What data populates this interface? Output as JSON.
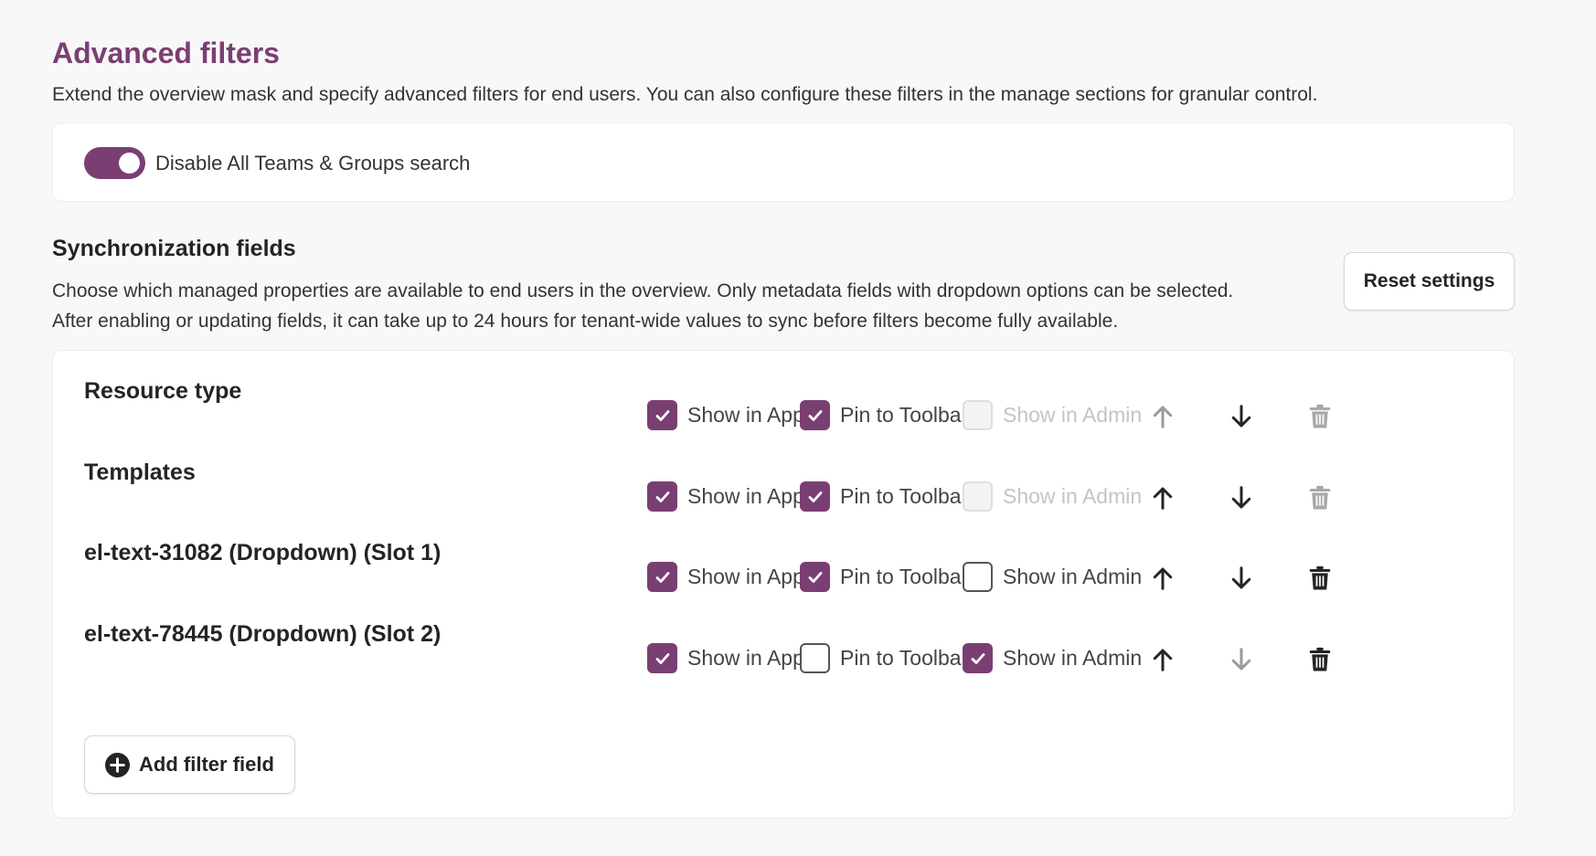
{
  "page": {
    "title": "Advanced filters",
    "description": "Extend the overview mask and specify advanced filters for end users. You can also configure these filters in the manage sections for granular control."
  },
  "toggle": {
    "label": "Disable All Teams & Groups search",
    "on": true
  },
  "sync": {
    "title": "Synchronization fields",
    "description_line1": "Choose which managed properties are available to end users in the overview. Only metadata fields with dropdown options can be selected.",
    "description_line2": "After enabling or updating fields, it can take up to 24 hours for tenant-wide values to sync before filters become fully available.",
    "reset_label": "Reset settings",
    "add_label": "Add filter field"
  },
  "labels": {
    "show_in_app": "Show in App",
    "pin_to_toolbar": "Pin to Toolbar",
    "show_in_admin": "Show in Admin"
  },
  "fields": [
    {
      "name": "Resource type",
      "show_in_app": true,
      "pin_to_toolbar": true,
      "show_in_admin": false,
      "admin_disabled": true,
      "up_enabled": false,
      "down_enabled": true,
      "delete_enabled": false
    },
    {
      "name": "Templates",
      "show_in_app": true,
      "pin_to_toolbar": true,
      "show_in_admin": false,
      "admin_disabled": true,
      "up_enabled": true,
      "down_enabled": true,
      "delete_enabled": false
    },
    {
      "name": "el-text-31082 (Dropdown) (Slot 1)",
      "show_in_app": true,
      "pin_to_toolbar": true,
      "show_in_admin": false,
      "admin_disabled": false,
      "up_enabled": true,
      "down_enabled": true,
      "delete_enabled": true
    },
    {
      "name": "el-text-78445 (Dropdown) (Slot 2)",
      "show_in_app": true,
      "pin_to_toolbar": false,
      "show_in_admin": true,
      "admin_disabled": false,
      "up_enabled": true,
      "down_enabled": false,
      "delete_enabled": true
    }
  ],
  "colors": {
    "accent": "#7a3f72",
    "disabled": "#c4c4c4"
  },
  "icons": [
    "checkmark-icon",
    "arrow-up-icon",
    "arrow-down-icon",
    "trash-icon",
    "plus-circle-icon"
  ]
}
